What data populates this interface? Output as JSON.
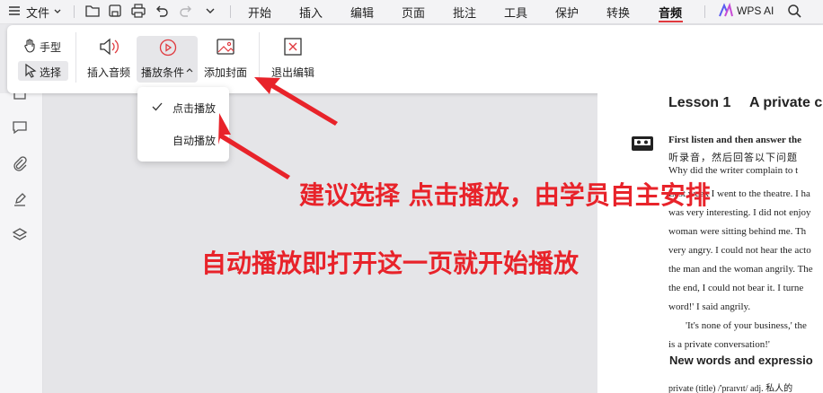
{
  "menubar": {
    "file_label": "文件",
    "tabs": [
      "开始",
      "插入",
      "编辑",
      "页面",
      "批注",
      "工具",
      "保护",
      "转换",
      "音频"
    ],
    "active_tab": "音频",
    "ai_label": "WPS AI",
    "accent": "#e0393e"
  },
  "ribbon": {
    "hand_label": "手型",
    "select_label": "选择",
    "insert_audio_label": "插入音频",
    "play_condition_label": "播放条件",
    "add_cover_label": "添加封面",
    "exit_edit_label": "退出编辑"
  },
  "dropdown": {
    "options": [
      "点击播放",
      "自动播放"
    ],
    "selected": "点击播放"
  },
  "annotations": {
    "line1": "建议选择 点击播放，由学员自主安排",
    "line2": "自动播放即打开这一页就开始播放",
    "color": "#e8232a"
  },
  "page": {
    "lesson_title": "Lesson 1",
    "lesson_subtitle": "A private c",
    "instruction_en": "First listen and then answer the",
    "instruction_cn": "听录音，然后回答以下问题",
    "question": "Why did the writer complain to t",
    "body_lines": [
      "Last week I went to the theatre. I ha",
      "was very interesting. I did not enjoy",
      "woman were sitting behind me. Th",
      "very angry. I could not hear the acto",
      "the man and the woman angrily. The",
      "the end, I could not bear it. I turne",
      "word!' I said angrily.",
      "'It's none of your business,' the",
      "is a private conversation!'"
    ],
    "vocab_heading": "New words and expressio",
    "vocab_line": "private (title) /'praɪvɪt/ adj. 私人的"
  }
}
